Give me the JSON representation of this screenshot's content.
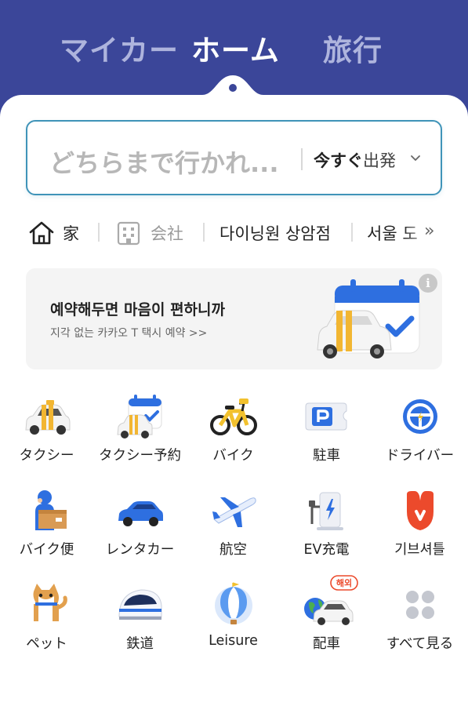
{
  "header": {
    "tabs": [
      {
        "label": "マイカー",
        "active": false
      },
      {
        "label": "ホーム",
        "active": true
      },
      {
        "label": "旅行",
        "active": false
      }
    ],
    "colors": {
      "header_bg": "#3b4699",
      "active_tab": "#ffffff",
      "inactive_tab": "#aeb4dd",
      "search_border": "#3f93b8"
    }
  },
  "search": {
    "placeholder": "どちらまで行かれ...",
    "depart_now": "今すぐ",
    "depart_label": "出発"
  },
  "shortcuts": {
    "home": {
      "label": "家",
      "icon": "house-icon"
    },
    "company": {
      "label": "会社",
      "icon": "building-icon"
    },
    "dining": {
      "label": "다이닝원 상암점"
    },
    "seoul": {
      "label": "서울 도"
    },
    "more": "»"
  },
  "banner": {
    "title": "예약해두면 마음이 편하니까",
    "subtitle": "지각 없는 카카오 T 택시 예약 >>",
    "info": "i"
  },
  "services": [
    {
      "label": "タクシー",
      "icon": "taxi-icon"
    },
    {
      "label": "タクシー予約",
      "icon": "taxi-reservation-icon"
    },
    {
      "label": "バイク",
      "icon": "bicycle-icon"
    },
    {
      "label": "駐車",
      "icon": "parking-icon"
    },
    {
      "label": "ドライバー",
      "icon": "steering-wheel-icon"
    },
    {
      "label": "バイク便",
      "icon": "courier-icon"
    },
    {
      "label": "レンタカー",
      "icon": "rental-car-icon"
    },
    {
      "label": "航空",
      "icon": "airplane-icon"
    },
    {
      "label": "EV充電",
      "icon": "ev-charger-icon"
    },
    {
      "label": "기브셔틀",
      "icon": "give-shuttle-icon"
    },
    {
      "label": "ペット",
      "icon": "pet-dog-icon"
    },
    {
      "label": "鉄道",
      "icon": "train-icon"
    },
    {
      "label": "Leisure",
      "icon": "balloon-icon"
    },
    {
      "label": "配車",
      "icon": "overseas-dispatch-icon",
      "badge": "해외"
    },
    {
      "label": "すべて見る",
      "icon": "view-all-icon"
    }
  ]
}
